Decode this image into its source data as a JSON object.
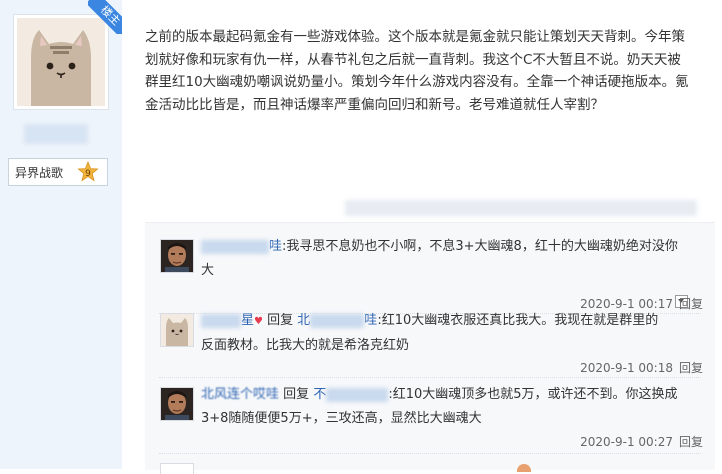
{
  "author": {
    "badge": "楼主",
    "level_name": "异界战歌",
    "level": "9"
  },
  "post": {
    "lines": [
      "之前的版本最起码氪金有一些游戏体验。这个版本就是氪金就只能让策划天天背刺。今年策",
      "划就好像和玩家有仇一样，从春节礼包之后就一直背刺。我这个C不大暂且不说。奶天天被",
      "群里红10大幽魂奶嘲讽说奶量小。策划今年什么游戏内容没有。全靠一个神话硬拖版本。氪",
      "金活动比比皆是，而且神话爆率严重偏向回归和新号。老号难道就任人宰割？"
    ]
  },
  "replies": [
    {
      "name_suffix": "哇",
      "reply_word": "",
      "reply_target_suffix": "",
      "text": ":我寻思不息奶也不小啊，不息3+大幽魂8，红十的大幽魂奶绝对没你",
      "text2": "大",
      "time": "2020-9-1 00:17",
      "reply_btn": "回复",
      "avatar_icon": "man-photo-icon"
    },
    {
      "name_suffix": "星",
      "reply_word": "回复",
      "reply_target_prefix": "北",
      "reply_target_suffix": "哇",
      "text": ":红10大幽魂衣服还真比我大。我现在就是群里的",
      "text2": "反面教材。比我大的就是希洛克红奶",
      "time": "2020-9-1 00:18",
      "reply_btn": "回复",
      "avatar_icon": "cat-avatar-icon"
    },
    {
      "name_suffix": "北风连个哎哇",
      "reply_word": "回复",
      "reply_target_prefix": "不",
      "reply_target_suffix": "",
      "text": ":红10大幽魂顶多也就5万，或许还不到。你这换成",
      "text2": "3+8随随便便5万+，三攻还高，显然比大幽魂大",
      "time": "2020-9-1 00:27",
      "reply_btn": "回复",
      "avatar_icon": "man-photo-icon"
    }
  ]
}
